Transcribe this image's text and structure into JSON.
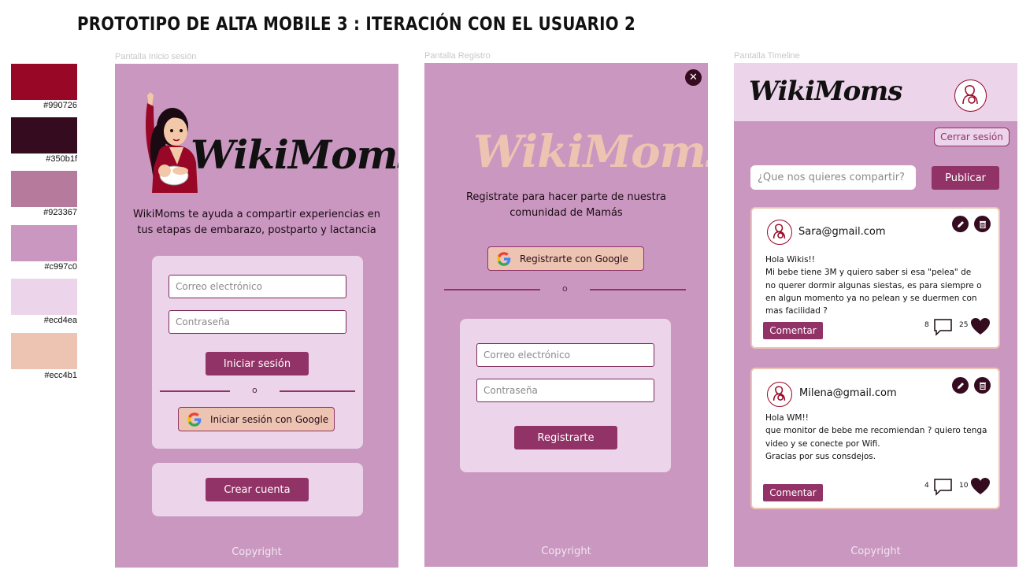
{
  "page_title": "PROTOTIPO DE ALTA MOBILE 3 : ITERACIÓN CON EL USUARIO 2",
  "palette": [
    {
      "hex": "#990726",
      "label": "#990726"
    },
    {
      "hex": "#350b1f",
      "label": "#350b1f"
    },
    {
      "hex": "#b67a9c",
      "label": "#923367"
    },
    {
      "hex": "#c997c0",
      "label": "#c997c0"
    },
    {
      "hex": "#ecd4ea",
      "label": "#ecd4ea"
    },
    {
      "hex": "#ecc4b1",
      "label": "#ecc4b1"
    }
  ],
  "login": {
    "caption": "Pantalla Inicio sesión",
    "logo": "WikiMoms",
    "tagline_1": "WikiMoms te ayuda a compartir experiencias en",
    "tagline_2": "tus etapas de embarazo, postparto y lactancia",
    "email_placeholder": "Correo electrónico",
    "password_placeholder": "Contraseña",
    "login_button": "Iniciar sesión",
    "divider": "o",
    "google_button": "Iniciar sesión con Google",
    "create_account_button": "Crear cuenta",
    "copyright": "Copyright"
  },
  "register": {
    "caption": "Pantalla Registro",
    "logo": "WikiMoms",
    "message_1": "Registrate para hacer parte de nuestra",
    "message_2": "comunidad de Mamás",
    "google_button": "Registrarte con Google",
    "divider": "o",
    "email_placeholder": "Correo electrónico",
    "password_placeholder": "Contraseña",
    "register_button": "Registrarte",
    "copyright": "Copyright"
  },
  "timeline": {
    "caption": "Pantalla Timeline",
    "logo": "WikiMoms",
    "logout_button": "Cerrar sesión",
    "post_placeholder": "¿Que nos quieres compartir?",
    "publish_button": "Publicar",
    "posts": [
      {
        "author": "Sara@gmail.com",
        "lines": [
          "Hola Wikis!!",
          "Mi bebe tiene 3M y quiero saber si esa \"pelea\" de",
          "no querer dormir algunas siestas, es para siempre o",
          "en algun momento ya no pelean y se duermen con",
          "mas facilidad ?"
        ],
        "comment_button": "Comentar",
        "comments": "8",
        "likes": "25"
      },
      {
        "author": "Milena@gmail.com",
        "lines": [
          "Hola WM!!",
          "que monitor de bebe me recomiendan ? quiero tenga",
          "video y se conecte por Wifi.",
          "Gracias por sus consdejos."
        ],
        "comment_button": "Comentar",
        "comments": "4",
        "likes": "10"
      }
    ],
    "copyright": "Copyright"
  }
}
